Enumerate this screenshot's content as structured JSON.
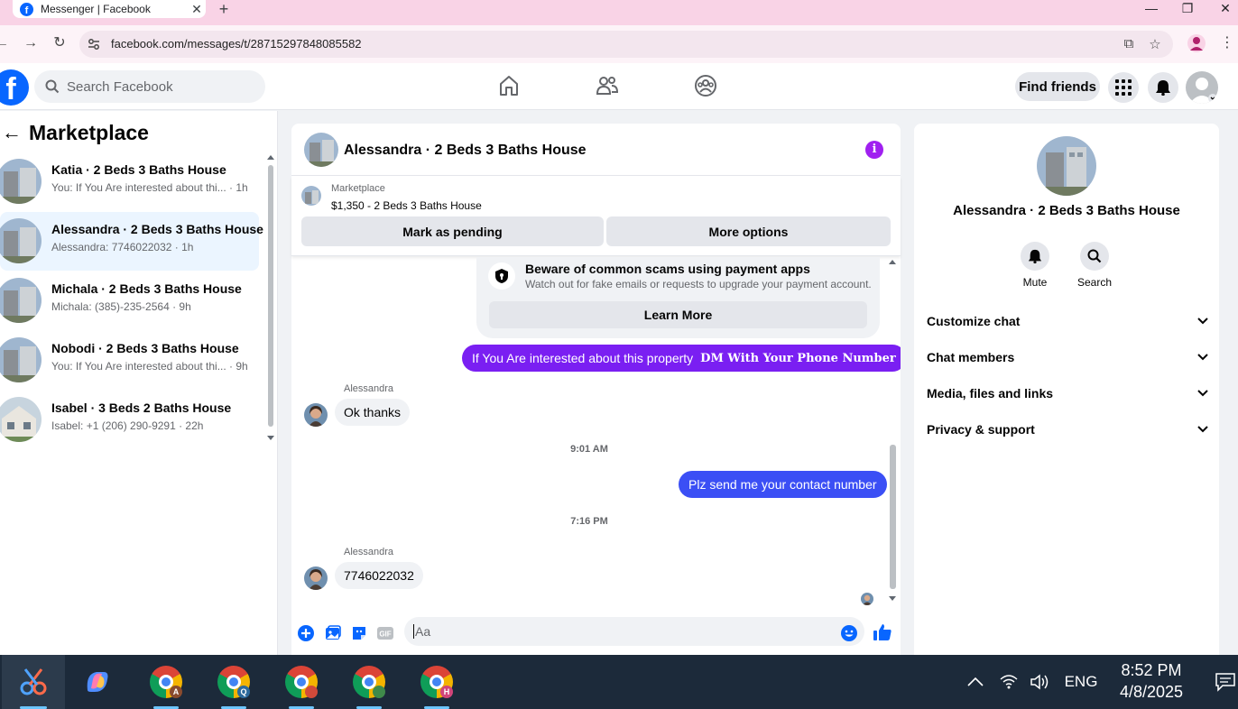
{
  "browser": {
    "tab_title": "Messenger | Facebook",
    "tab_close": "✕",
    "new_tab": "+",
    "url": "facebook.com/messages/t/28715297848085582",
    "minimize": "—",
    "maximize": "❐",
    "close": "✕"
  },
  "fb_header": {
    "logo_letter": "f",
    "search_placeholder": "Search Facebook",
    "find_friends": "Find friends"
  },
  "left": {
    "back": "←",
    "title": "Marketplace",
    "conversations": [
      {
        "name": "Katia · 2 Beds 3 Baths House",
        "preview": "You: If You Are interested about thi... · 1h"
      },
      {
        "name": "Alessandra · 2 Beds 3 Baths House",
        "preview": "Alessandra: 7746022032 · 1h"
      },
      {
        "name": "Michala · 2 Beds 3 Baths House",
        "preview": "Michala: (385)-235-2564 · 9h"
      },
      {
        "name": "Nobodi · 2 Beds 3 Baths House",
        "preview": "You: If You Are interested about thi... · 9h"
      },
      {
        "name": "Isabel · 3 Beds 2 Baths House",
        "preview": "Isabel: +1 (206) 290-9291 · 22h"
      }
    ]
  },
  "chat": {
    "title": "Alessandra · 2 Beds 3 Baths House",
    "info_icon": "i",
    "marketplace_label": "Marketplace",
    "listing": "$1,350 - 2 Beds 3 Baths House",
    "mark_pending": "Mark as pending",
    "more_options": "More options",
    "scam_title": "Beware of common scams using payment apps",
    "scam_desc": "Watch out for fake emails or requests to upgrade your payment account.",
    "learn_more": "Learn More",
    "outgoing_1_text": "If You Are interested about this property",
    "outgoing_1_emphasis": "DM With Your Phone Number",
    "sender_1": "Alessandra",
    "incoming_1": "Ok thanks",
    "time_1": "9:01 AM",
    "outgoing_2": "Plz send me your contact number",
    "time_2": "7:16 PM",
    "sender_2": "Alessandra",
    "incoming_2": "7746022032",
    "composer_placeholder": "Aa",
    "outgoing_color": "#7a1ff2",
    "outgoing_color_2": "#3b4ff5"
  },
  "right": {
    "name": "Alessandra · 2 Beds 3 Baths House",
    "mute": "Mute",
    "search": "Search",
    "sections": [
      "Customize chat",
      "Chat members",
      "Media, files and links",
      "Privacy & support"
    ]
  },
  "taskbar": {
    "lang": "ENG",
    "time": "8:52 PM",
    "date": "4/8/2025",
    "chrome_badges": [
      "A",
      "Q",
      "",
      "",
      "H"
    ]
  }
}
